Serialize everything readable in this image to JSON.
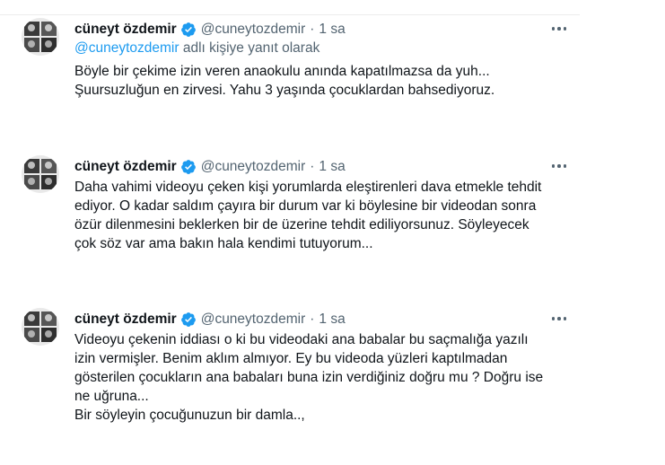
{
  "tweets": [
    {
      "author_name": "cüneyt özdemir",
      "author_handle": "@cuneytozdemir",
      "separator": "·",
      "time": "1 sa",
      "reply_handle": "@cuneytozdemir",
      "reply_suffix": " adlı kişiye yanıt olarak",
      "lines": [
        "Böyle bir çekime izin veren anaokulu anında kapatılmazsa da yuh...",
        "Şuursuzluğun en zirvesi. Yahu 3 yaşında çocuklardan bahsediyoruz."
      ]
    },
    {
      "author_name": "cüneyt özdemir",
      "author_handle": "@cuneytozdemir",
      "separator": "·",
      "time": "1 sa",
      "lines": [
        "Daha vahimi videoyu çeken kişi yorumlarda eleştirenleri dava etmekle tehdit",
        "ediyor. O kadar saldım çayıra bir durum var ki böylesine bir videodan sonra",
        "özür dilenmesini beklerken bir de üzerine tehdit ediliyorsunuz. Söyleyecek",
        "çok söz var ama bakın hala kendimi tutuyorum..."
      ]
    },
    {
      "author_name": "cüneyt özdemir",
      "author_handle": "@cuneytozdemir",
      "separator": "·",
      "time": "1 sa",
      "lines": [
        "Videoyu çekenin iddiası o ki bu videodaki ana babalar bu saçmalığa yazılı",
        "izin vermişler. Benim aklım almıyor. Ey bu videoda yüzleri kaptılmadan",
        "gösterilen çocukların ana babaları buna izin verdiğiniz doğru mu ? Doğru ise",
        "ne uğruna...",
        "Bir söyleyin çocuğunuzun bir damla..,"
      ]
    }
  ],
  "icons": {
    "verified": "verified-badge-icon",
    "more": "more-horizontal-icon",
    "avatar": "profile-photo-grid"
  },
  "colors": {
    "text": "#0f1419",
    "secondary": "#536471",
    "link": "#1d9bf0",
    "verified": "#1d9bf0"
  }
}
